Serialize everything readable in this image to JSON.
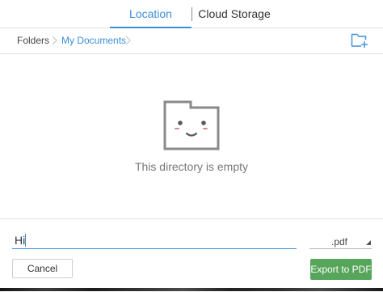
{
  "tabs": [
    {
      "label": "Location",
      "active": true
    },
    {
      "label": "Cloud Storage",
      "active": false
    }
  ],
  "breadcrumb": {
    "items": [
      "Folders",
      "My Documents"
    ],
    "separator_icon": "chevron-right-icon",
    "new_folder_icon": "new-folder-icon"
  },
  "empty_state": {
    "icon": "sad-folder-icon",
    "message": "This directory is empty"
  },
  "save": {
    "filename_value": "Hi",
    "format_value": ".pdf",
    "format_dropdown_icon": "dropdown-triangle-icon",
    "cancel_label": "Cancel",
    "export_label": "Export to PDF"
  },
  "colors": {
    "accent": "#3a8fd8",
    "export_button": "#56a55a",
    "folder_icon": "#8a8a8a",
    "divider": "#e2e2e2"
  }
}
